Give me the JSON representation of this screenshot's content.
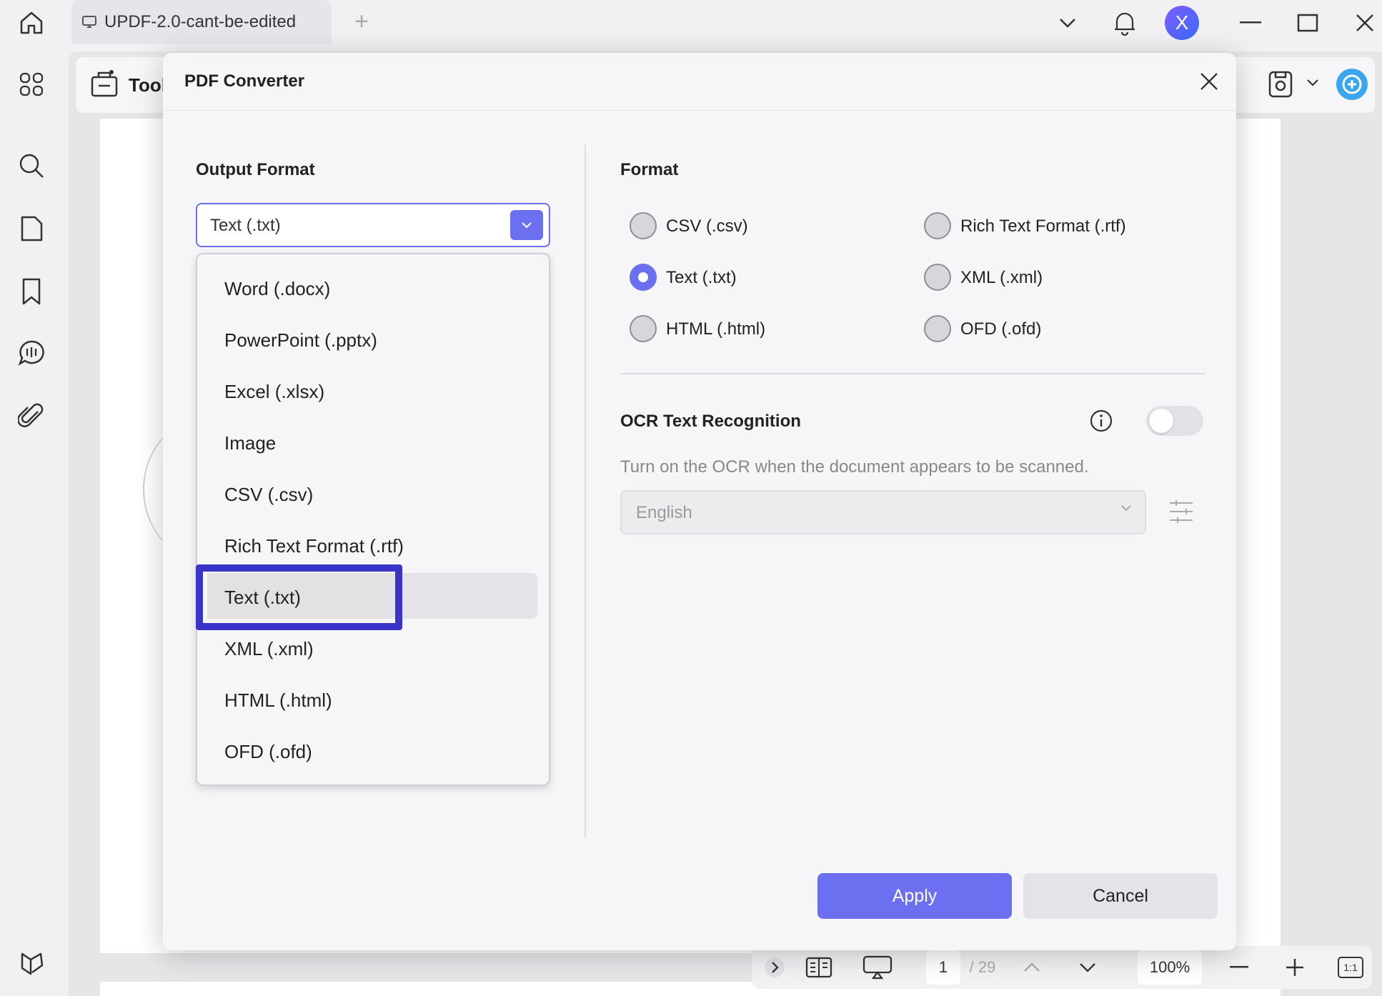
{
  "titlebar": {
    "tab_title": "UPDF-2.0-cant-be-edited",
    "add_tab": "+",
    "avatar_letter": "X",
    "icons": [
      "home-icon",
      "file-tab-icon",
      "chevron-down-icon",
      "bell-icon",
      "minimize-icon",
      "maximize-icon",
      "close-icon"
    ]
  },
  "sidebar": {
    "icons": [
      "apps-grid-icon",
      "search-icon",
      "page-icon",
      "bookmark-icon",
      "comment-icon",
      "attachment-icon",
      "layers-icon"
    ]
  },
  "toolbar": {
    "tool_label": "Tool"
  },
  "bottom_bar": {
    "page_current": "1",
    "page_total": "/ 29",
    "zoom": "100%",
    "fit": "1:1"
  },
  "modal": {
    "title": "PDF Converter",
    "output_format_title": "Output Format",
    "selected_format": "Text (.txt)",
    "dropdown_items": [
      "Word (.docx)",
      "PowerPoint (.pptx)",
      "Excel (.xlsx)",
      "Image",
      "CSV (.csv)",
      "Rich Text Format (.rtf)",
      "Text (.txt)",
      "XML (.xml)",
      "HTML (.html)",
      "OFD (.ofd)"
    ],
    "format_title": "Format",
    "format_options": [
      {
        "label": "CSV (.csv)",
        "selected": false
      },
      {
        "label": "Rich Text Format (.rtf)",
        "selected": false
      },
      {
        "label": "Text (.txt)",
        "selected": true
      },
      {
        "label": "XML (.xml)",
        "selected": false
      },
      {
        "label": "HTML (.html)",
        "selected": false
      },
      {
        "label": "OFD (.ofd)",
        "selected": false
      }
    ],
    "ocr_title": "OCR Text Recognition",
    "ocr_enabled": false,
    "ocr_description": "Turn on the OCR when the document appears to be scanned.",
    "ocr_language": "English",
    "apply_label": "Apply",
    "cancel_label": "Cancel"
  },
  "colors": {
    "accent": "#6b6ff0",
    "highlight_border": "#3a35c8",
    "background": "#f1f1f3"
  }
}
